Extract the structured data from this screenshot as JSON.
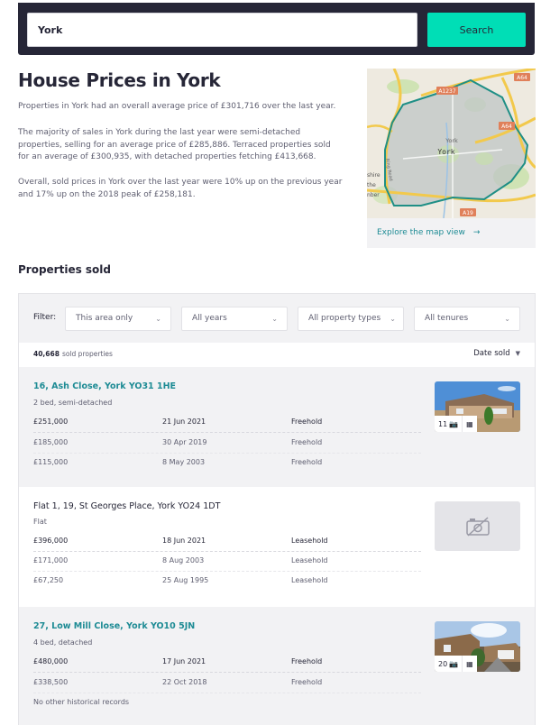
{
  "search": {
    "value": "York",
    "button_label": "Search"
  },
  "page": {
    "title": "House Prices in York",
    "intro": [
      "Properties in York had an overall average price of £301,716 over the last year.",
      "The majority of sales in York during the last year were semi-detached properties, selling for an average price of £285,886. Terraced properties sold for an average of £300,935, with detached properties fetching £413,668.",
      "Overall, sold prices in York over the last year were 10% up on the previous year and 17% up on the 2018 peak of £258,181."
    ]
  },
  "map": {
    "labels": {
      "city": "York",
      "city_small": "York",
      "road_a1237": "A1237",
      "road_a64_top": "A64",
      "road_a64_right": "A64",
      "road_a19": "A19",
      "ring_road": "Ring Road",
      "region_partial": [
        "shire",
        "the",
        "nber"
      ]
    },
    "explore_link": "Explore the map view",
    "explore_arrow": "→"
  },
  "properties_section": {
    "title": "Properties sold",
    "filter_label": "Filter:",
    "filters": [
      {
        "label": "This area only"
      },
      {
        "label": "All years"
      },
      {
        "label": "All property types"
      },
      {
        "label": "All tenures"
      }
    ],
    "count": "40,668",
    "count_suffix": "sold properties",
    "sort_label": "Date sold",
    "listings": [
      {
        "address": "16, Ash Close, York YO31 1HE",
        "type": "2 bed, semi-detached",
        "photos": "11",
        "has_photo": true,
        "sales": [
          {
            "price": "£251,000",
            "date": "21 Jun 2021",
            "tenure": "Freehold"
          },
          {
            "price": "£185,000",
            "date": "30 Apr 2019",
            "tenure": "Freehold"
          },
          {
            "price": "£115,000",
            "date": "8 May 2003",
            "tenure": "Freehold"
          }
        ]
      },
      {
        "address": "Flat 1, 19, St Georges Place, York YO24 1DT",
        "type": "Flat",
        "has_photo": false,
        "sales": [
          {
            "price": "£396,000",
            "date": "18 Jun 2021",
            "tenure": "Leasehold"
          },
          {
            "price": "£171,000",
            "date": "8 Aug 2003",
            "tenure": "Leasehold"
          },
          {
            "price": "£67,250",
            "date": "25 Aug 1995",
            "tenure": "Leasehold"
          }
        ]
      },
      {
        "address": "27, Low Mill Close, York YO10 5JN",
        "type": "4 bed, detached",
        "photos": "20",
        "has_photo": true,
        "sales": [
          {
            "price": "£480,000",
            "date": "17 Jun 2021",
            "tenure": "Freehold"
          },
          {
            "price": "£338,500",
            "date": "22 Oct 2018",
            "tenure": "Freehold"
          }
        ],
        "note": "No other historical records"
      }
    ]
  },
  "colors": {
    "brand_dark": "#262637",
    "accent": "#00deb6",
    "link": "#1d8b94",
    "panel": "#f2f2f4"
  }
}
